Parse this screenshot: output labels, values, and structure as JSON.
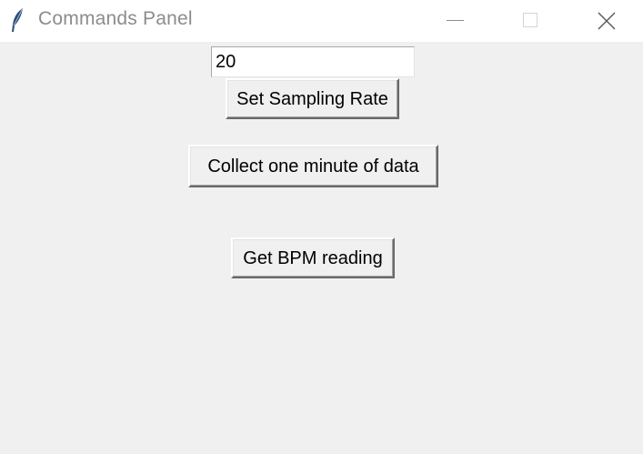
{
  "window": {
    "title": "Commands Panel",
    "icon": "feather-icon",
    "controls": {
      "minimize": "minimize-icon",
      "maximize": "maximize-icon",
      "close": "close-icon"
    }
  },
  "sampling": {
    "rate_value": "20",
    "set_rate_label": "Set Sampling Rate"
  },
  "actions": {
    "collect_label": "Collect one minute of data",
    "bpm_label": "Get BPM reading"
  },
  "colors": {
    "titlebar_bg": "#ffffff",
    "window_bg": "#f0f0f0",
    "title_text": "#8c8c8c"
  }
}
